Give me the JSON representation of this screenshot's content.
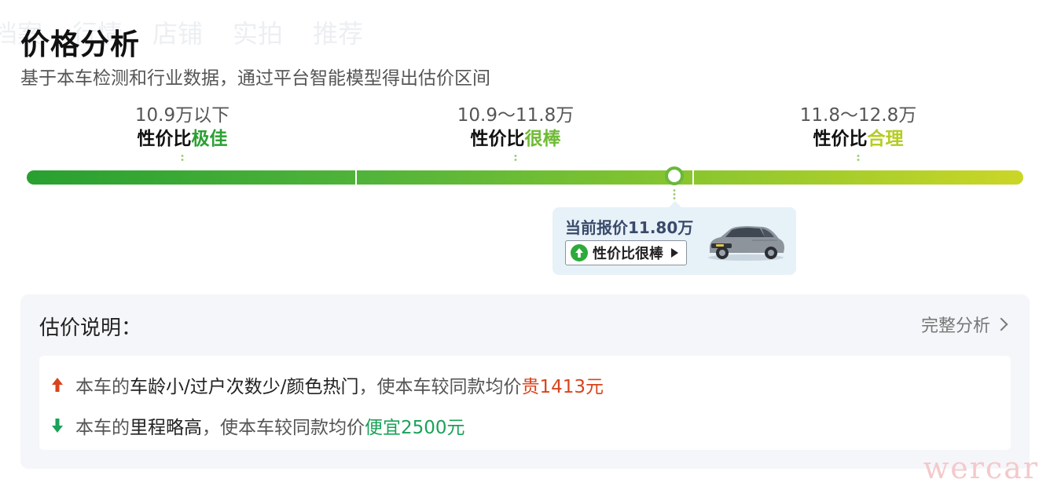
{
  "ghost_tabs": [
    "档案",
    "行情",
    "店铺",
    "实拍",
    "推荐"
  ],
  "title": "价格分析",
  "subtitle": "基于本车检测和行业数据，通过平台智能模型得出估价区间",
  "ranges": [
    {
      "value": "10.9万以下",
      "rating_prefix": "性价比",
      "rating": "极佳",
      "color": "#2ba032"
    },
    {
      "value": "10.9～11.8万",
      "rating_prefix": "性价比",
      "rating": "很棒",
      "color": "#6fbb35"
    },
    {
      "value": "11.8～12.8万",
      "rating_prefix": "性价比",
      "rating": "合理",
      "color": "#b6cc22"
    }
  ],
  "current_price": {
    "label": "当前报价11.80万",
    "badge": "性价比很棒",
    "icons": [
      "up-arrow-icon",
      "play-icon",
      "car-image"
    ]
  },
  "explain": {
    "title": "估价说明：",
    "full_analysis": "完整分析",
    "reasons": [
      {
        "direction": "up",
        "prefix": "本车的",
        "factor": "车龄小/过户次数少/颜色热门",
        "middle": "，使本车较同款均价",
        "effect": "贵1413元",
        "color": "#d9441c"
      },
      {
        "direction": "down",
        "prefix": "本车的",
        "factor": "里程略高",
        "middle": "，使本车较同款均价",
        "effect": "便宜2500元",
        "color": "#1aa259"
      }
    ]
  },
  "watermark": "wercar",
  "colors": {
    "red": "#d9441c",
    "green": "#1aa259",
    "track_start": "#28a030",
    "track_end": "#cbd627"
  }
}
